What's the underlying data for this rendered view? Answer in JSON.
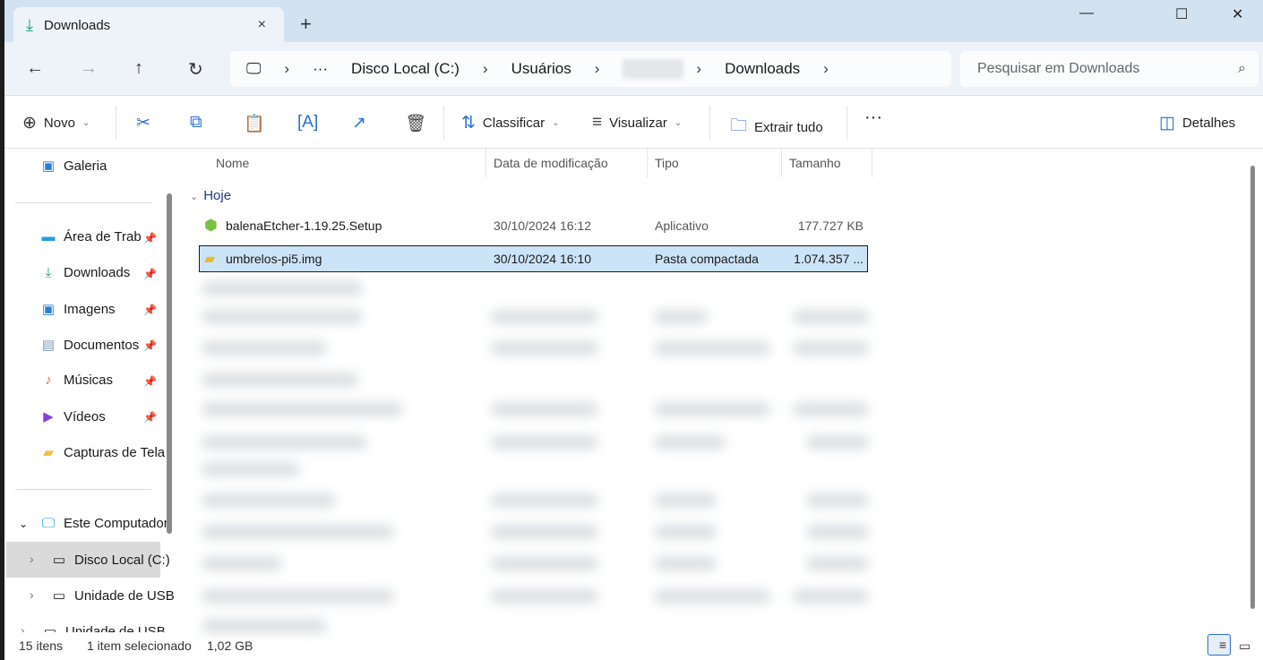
{
  "window": {
    "tab_title": "Downloads",
    "tab_icon": "download-icon",
    "close_tab": "×",
    "new_tab": "+",
    "minimize": "—",
    "maximize": "☐",
    "close": "✕"
  },
  "address": {
    "segments": [
      "Disco Local (C:)",
      "Usuários",
      "Downloads"
    ],
    "overflow": "···",
    "redacted_segment": true
  },
  "search": {
    "placeholder": "Pesquisar em Downloads"
  },
  "toolbar": {
    "new_label": "Novo",
    "sort_label": "Classificar",
    "view_label": "Visualizar",
    "extract_label": "Extrair tudo",
    "more_label": "···",
    "details_label": "Detalhes"
  },
  "sidebar": {
    "gallery": "Galeria",
    "quick": [
      {
        "label": "Área de Trab",
        "icon": "desktop-icon"
      },
      {
        "label": "Downloads",
        "icon": "download-icon"
      },
      {
        "label": "Imagens",
        "icon": "pictures-icon"
      },
      {
        "label": "Documentos",
        "icon": "documents-icon"
      },
      {
        "label": "Músicas",
        "icon": "music-icon"
      },
      {
        "label": "Vídeos",
        "icon": "videos-icon"
      },
      {
        "label": "Capturas de Tela",
        "icon": "folder-icon"
      }
    ],
    "this_pc": "Este Computador",
    "drives": [
      "Disco Local (C:)",
      "Unidade de USB",
      "Unidade de USB"
    ]
  },
  "columns": {
    "name": "Nome",
    "modified": "Data de modificação",
    "type": "Tipo",
    "size": "Tamanho"
  },
  "group": "Hoje",
  "files": [
    {
      "name": "balenaEtcher-1.19.25.Setup",
      "modified": "30/10/2024 16:12",
      "type": "Aplicativo",
      "size": "177.727 KB",
      "selected": false
    },
    {
      "name": "umbrelos-pi5.img",
      "modified": "30/10/2024 16:10",
      "type": "Pasta compactada",
      "size": "1.074.357 ...",
      "selected": true
    }
  ],
  "status": {
    "count": "15 itens",
    "selected": "1 item selecionado",
    "size": "1,02 GB"
  },
  "colors": {
    "titlebar": "#d3e2f0",
    "selection": "#cce4f7",
    "accent": "#2a6fd0"
  }
}
